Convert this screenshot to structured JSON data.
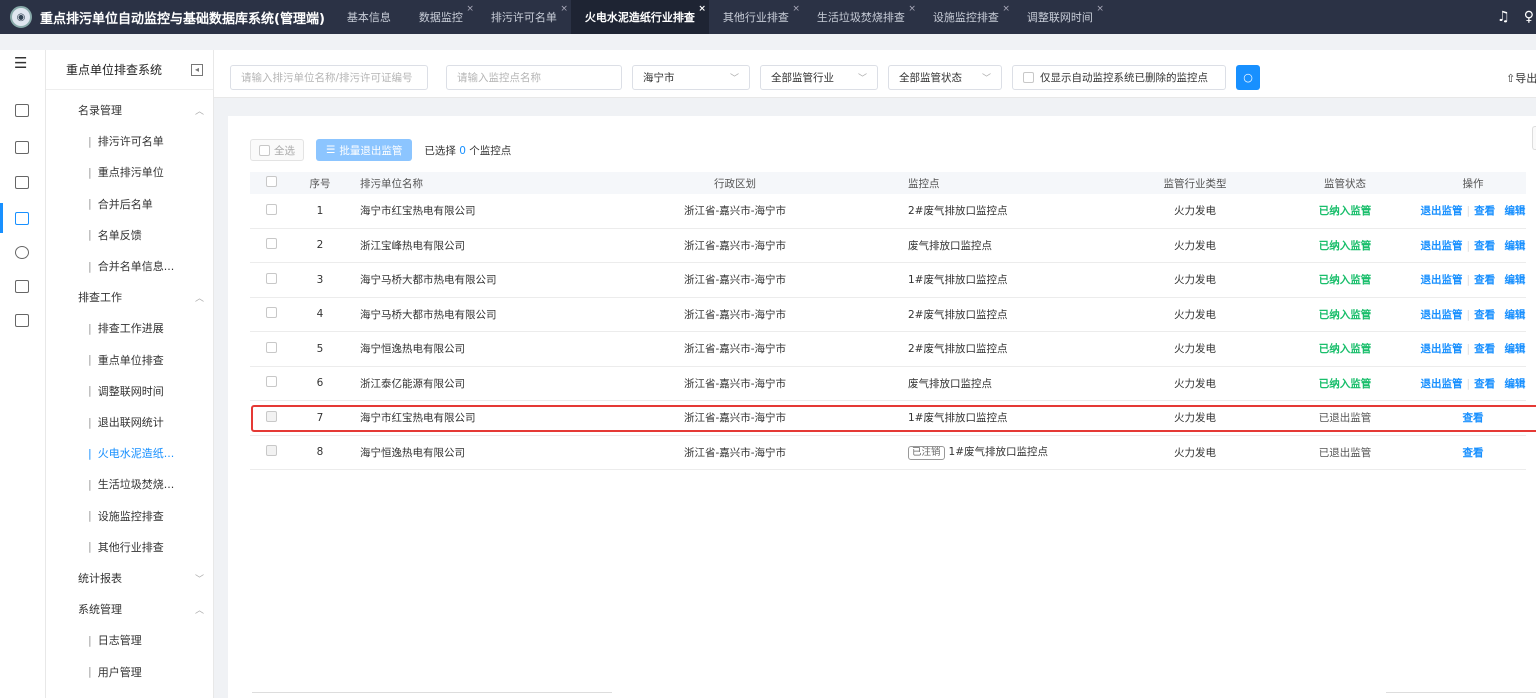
{
  "app_title": "重点排污单位自动监控与基础数据库系统(管理端)",
  "tabs": [
    {
      "label": "基本信息",
      "closable": false,
      "active": false
    },
    {
      "label": "数据监控",
      "closable": true,
      "active": false
    },
    {
      "label": "排污许可名单",
      "closable": true,
      "active": false
    },
    {
      "label": "火电水泥造纸行业排查",
      "closable": true,
      "active": true
    },
    {
      "label": "其他行业排查",
      "closable": true,
      "active": false
    },
    {
      "label": "生活垃圾焚烧排查",
      "closable": true,
      "active": false
    },
    {
      "label": "设施监控排查",
      "closable": true,
      "active": false
    },
    {
      "label": "调整联网时间",
      "closable": true,
      "active": false
    }
  ],
  "sidebar": {
    "title": "重点单位排查系统",
    "groups": [
      {
        "label": "名录管理",
        "items": [
          "排污许可名单",
          "重点排污单位",
          "合并后名单",
          "名单反馈",
          "合并名单信息..."
        ]
      },
      {
        "label": "排查工作",
        "items": [
          "排查工作进展",
          "重点单位排查",
          "调整联网时间",
          "退出联网统计",
          "火电水泥造纸...",
          "生活垃圾焚烧...",
          "设施监控排查",
          "其他行业排查"
        ]
      },
      {
        "label": "统计报表",
        "items": []
      },
      {
        "label": "系统管理",
        "items": [
          "日志管理",
          "用户管理"
        ]
      }
    ],
    "active_item": "火电水泥造纸..."
  },
  "filters": {
    "unit_placeholder": "请输入排污单位名称/排污许可证编号",
    "point_placeholder": "请输入监控点名称",
    "city": "海宁市",
    "industry": "全部监管行业",
    "status": "全部监管状态",
    "deleted_only_label": "仅显示自动监控系统已删除的监控点",
    "export_label": "导出"
  },
  "toolbar": {
    "select_all": "全选",
    "batch_exit": "批量退出监管",
    "selected_prefix": "已选择",
    "selected_count": "0",
    "selected_suffix": "个监控点"
  },
  "table": {
    "headers": {
      "idx": "序号",
      "name": "排污单位名称",
      "region": "行政区划",
      "point": "监控点",
      "industry": "监管行业类型",
      "status": "监管状态",
      "ops": "操作"
    },
    "op_labels": {
      "exit": "退出监管",
      "view": "查看",
      "edit": "编辑"
    },
    "rows": [
      {
        "idx": "1",
        "name": "海宁市红宝热电有限公司",
        "region": "浙江省-嘉兴市-海宁市",
        "tag": "",
        "point": "2#废气排放口监控点",
        "industry": "火力发电",
        "status": "已纳入监管",
        "status_type": "in"
      },
      {
        "idx": "2",
        "name": "浙江宝峰热电有限公司",
        "region": "浙江省-嘉兴市-海宁市",
        "tag": "",
        "point": "废气排放口监控点",
        "industry": "火力发电",
        "status": "已纳入监管",
        "status_type": "in"
      },
      {
        "idx": "3",
        "name": "海宁马桥大都市热电有限公司",
        "region": "浙江省-嘉兴市-海宁市",
        "tag": "",
        "point": "1#废气排放口监控点",
        "industry": "火力发电",
        "status": "已纳入监管",
        "status_type": "in"
      },
      {
        "idx": "4",
        "name": "海宁马桥大都市热电有限公司",
        "region": "浙江省-嘉兴市-海宁市",
        "tag": "",
        "point": "2#废气排放口监控点",
        "industry": "火力发电",
        "status": "已纳入监管",
        "status_type": "in"
      },
      {
        "idx": "5",
        "name": "海宁恒逸热电有限公司",
        "region": "浙江省-嘉兴市-海宁市",
        "tag": "",
        "point": "2#废气排放口监控点",
        "industry": "火力发电",
        "status": "已纳入监管",
        "status_type": "in"
      },
      {
        "idx": "6",
        "name": "浙江泰亿能源有限公司",
        "region": "浙江省-嘉兴市-海宁市",
        "tag": "",
        "point": "废气排放口监控点",
        "industry": "火力发电",
        "status": "已纳入监管",
        "status_type": "in"
      },
      {
        "idx": "7",
        "name": "海宁市红宝热电有限公司",
        "region": "浙江省-嘉兴市-海宁市",
        "tag": "",
        "point": "1#废气排放口监控点",
        "industry": "火力发电",
        "status": "已退出监管",
        "status_type": "out"
      },
      {
        "idx": "8",
        "name": "海宁恒逸热电有限公司",
        "region": "浙江省-嘉兴市-海宁市",
        "tag": "已注销",
        "point": "1#废气排放口监控点",
        "industry": "火力发电",
        "status": "已退出监管",
        "status_type": "out"
      }
    ]
  },
  "colors": {
    "topbar": "#2b3245",
    "accent": "#1890ff",
    "status_in": "#19be6b",
    "highlight": "#e53935"
  }
}
